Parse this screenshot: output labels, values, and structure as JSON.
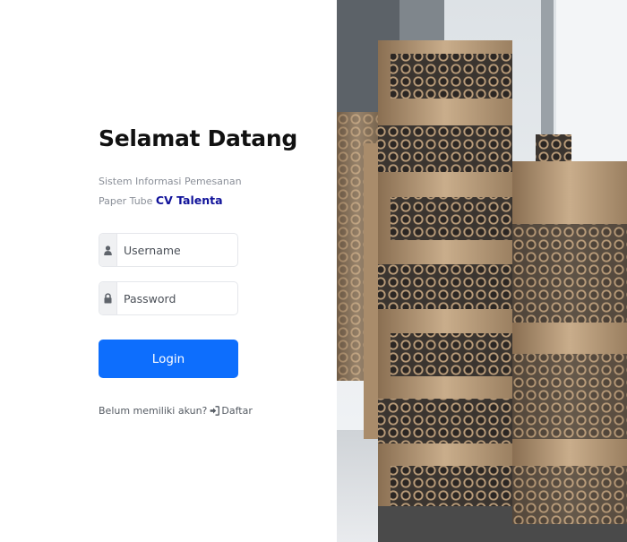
{
  "login": {
    "title": "Selamat Datang",
    "subtitle": "Sistem Informasi Pemesanan Paper Tube",
    "company": "CV Talenta",
    "username_placeholder": "Username",
    "password_placeholder": "Password",
    "login_label": "Login",
    "register_prompt": "Belum memiliki akun?",
    "register_link": "Daftar"
  },
  "icons": {
    "username": "user-icon",
    "password": "lock-icon",
    "register": "sign-in-icon"
  },
  "colors": {
    "accent": "#0d6efd",
    "brand": "#10129a"
  }
}
